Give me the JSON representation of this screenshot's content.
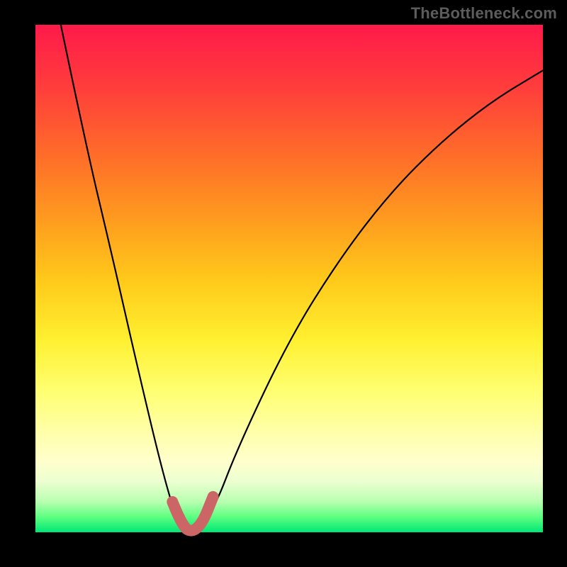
{
  "watermark": "TheBottleneck.com",
  "chart_data": {
    "type": "line",
    "title": "",
    "xlabel": "",
    "ylabel": "",
    "xlim": [
      0,
      1
    ],
    "ylim": [
      0,
      1
    ],
    "series": [
      {
        "name": "curve",
        "color": "#000000",
        "x": [
          0.05,
          0.1,
          0.15,
          0.2,
          0.25,
          0.28,
          0.31,
          0.35,
          0.4,
          0.5,
          0.6,
          0.7,
          0.8,
          0.9,
          1.0
        ],
        "y": [
          1.0,
          0.76,
          0.55,
          0.33,
          0.12,
          0.02,
          0.0,
          0.04,
          0.17,
          0.38,
          0.54,
          0.67,
          0.77,
          0.85,
          0.91
        ]
      },
      {
        "name": "minimum-marker",
        "color": "#cc6666",
        "x": [
          0.27,
          0.29,
          0.31,
          0.33,
          0.35
        ],
        "y": [
          0.06,
          0.01,
          0.0,
          0.02,
          0.07
        ]
      }
    ],
    "annotations": []
  }
}
